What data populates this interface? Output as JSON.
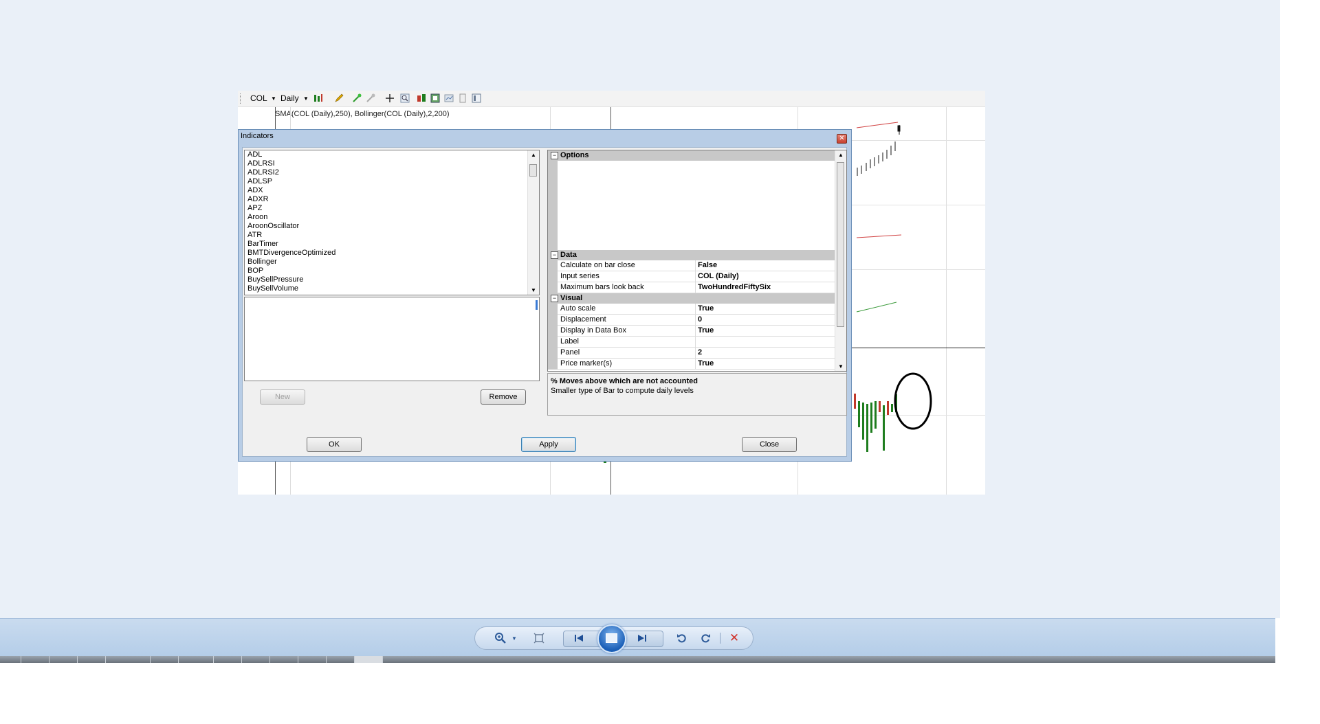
{
  "toolbar": {
    "instrument": "COL",
    "interval": "Daily"
  },
  "chart": {
    "indicator_label": "SMA(COL (Daily),250), Bollinger(COL (Daily),2,200)"
  },
  "dialog": {
    "title": "Indicators",
    "indicators": [
      "ADL",
      "ADLRSI",
      "ADLRSI2",
      "ADLSP",
      "ADX",
      "ADXR",
      "APZ",
      "Aroon",
      "AroonOscillator",
      "ATR",
      "BarTimer",
      "BMTDivergenceOptimized",
      "Bollinger",
      "BOP",
      "BuySellPressure",
      "BuySellVolume"
    ],
    "buttons": {
      "new": "New",
      "remove": "Remove",
      "ok": "OK",
      "apply": "Apply",
      "close": "Close"
    },
    "property_grid": {
      "categories": {
        "options": "Options",
        "data": "Data",
        "visual": "Visual"
      },
      "data_rows": [
        {
          "name": "Calculate on bar close",
          "value": "False"
        },
        {
          "name": "Input series",
          "value": "COL (Daily)"
        },
        {
          "name": "Maximum bars look back",
          "value": "TwoHundredFiftySix"
        }
      ],
      "visual_rows": [
        {
          "name": "Auto scale",
          "value": "True"
        },
        {
          "name": "Displacement",
          "value": "0"
        },
        {
          "name": "Display in Data Box",
          "value": "True"
        },
        {
          "name": "Label",
          "value": ""
        },
        {
          "name": "Panel",
          "value": "2"
        },
        {
          "name": "Price marker(s)",
          "value": "True"
        }
      ]
    },
    "description": {
      "title": "% Moves above which are not accounted",
      "text": "Smaller type of Bar to compute daily levels"
    }
  },
  "colors": {
    "bull": "#1e7d1e",
    "bear": "#c0392b",
    "dialog_frame": "#b8cde6",
    "viewer_bar": "#c1d6ec"
  },
  "icons": {
    "zoom": "magnifier-icon",
    "fit": "fit-window-icon",
    "prev": "previous-icon",
    "slideshow": "slideshow-icon",
    "next": "next-icon",
    "rotate_left": "rotate-ccw-icon",
    "rotate_right": "rotate-cw-icon",
    "delete": "delete-icon"
  }
}
